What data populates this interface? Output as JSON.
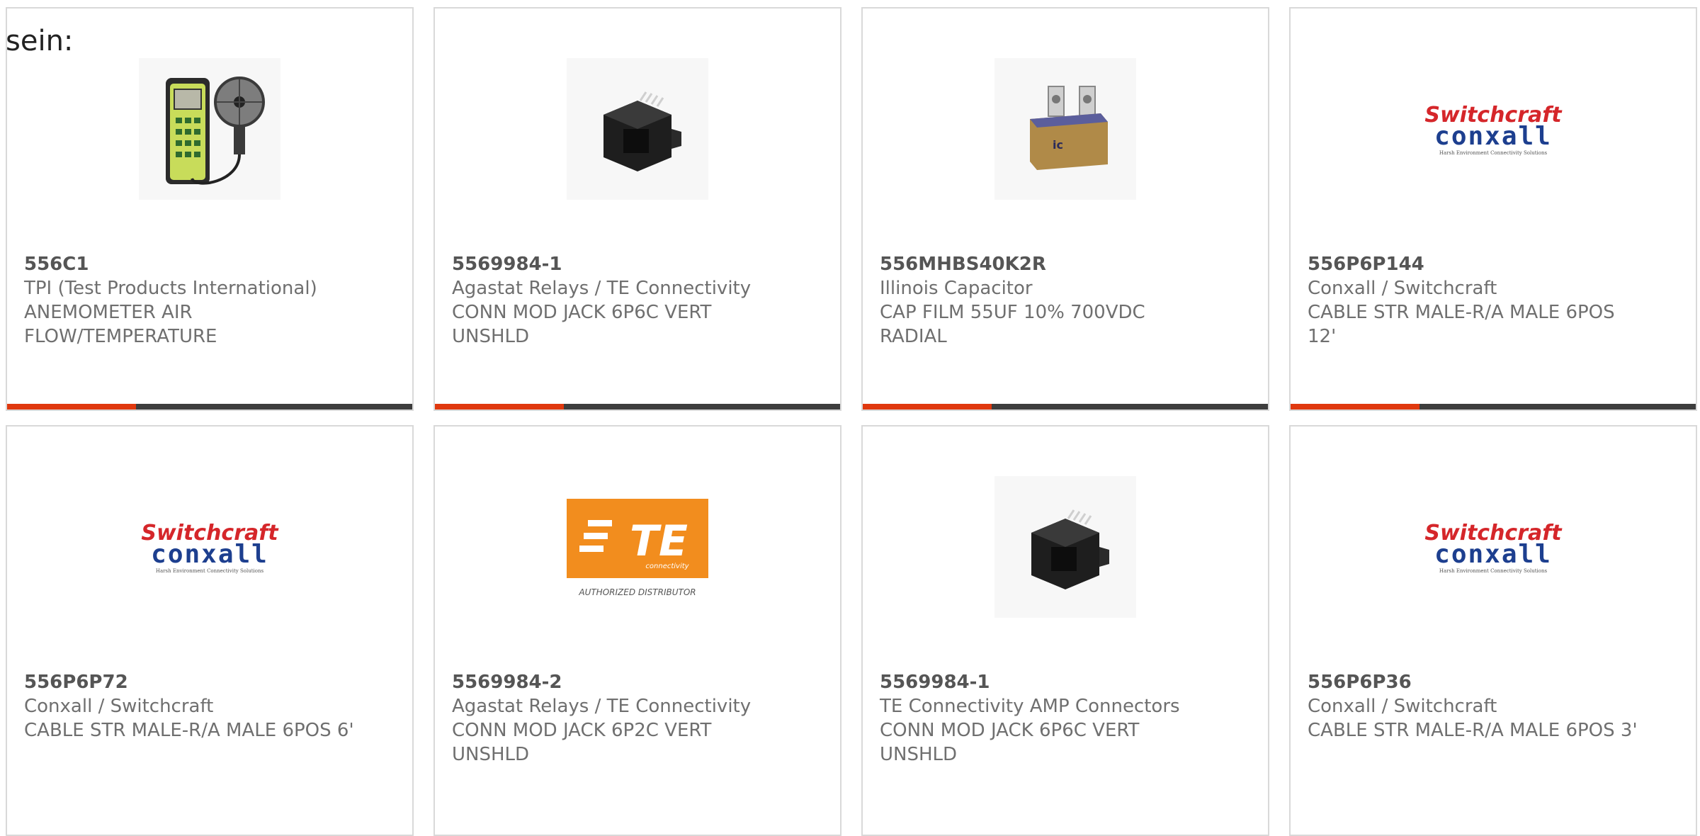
{
  "intro_text": "sein:",
  "colors": {
    "accent": "#e0380e",
    "bar": "#3d3d3d",
    "border": "#d9d9d9",
    "text": "#6f6f6f"
  },
  "products": [
    {
      "part_number": "556C1",
      "manufacturer": "TPI (Test Products International)",
      "description": "ANEMOMETER AIR FLOW/TEMPERATURE",
      "image": "anemometer-image"
    },
    {
      "part_number": "5569984-1",
      "manufacturer": "Agastat Relays / TE Connectivity",
      "description": "CONN MOD JACK 6P6C VERT UNSHLD",
      "image": "modular-jack-image"
    },
    {
      "part_number": "556MHBS40K2R",
      "manufacturer": "Illinois Capacitor",
      "description": "CAP FILM 55UF 10% 700VDC RADIAL",
      "image": "film-capacitor-image"
    },
    {
      "part_number": "556P6P144",
      "manufacturer": "Conxall / Switchcraft",
      "description": "CABLE STR MALE-R/A MALE 6POS 12'",
      "image": "switchcraft-conxall-logo"
    },
    {
      "part_number": "556P6P72",
      "manufacturer": "Conxall / Switchcraft",
      "description": "CABLE STR MALE-R/A MALE 6POS 6'",
      "image": "switchcraft-conxall-logo"
    },
    {
      "part_number": "5569984-2",
      "manufacturer": "Agastat Relays / TE Connectivity",
      "description": "CONN MOD JACK 6P2C VERT UNSHLD",
      "image": "te-connectivity-logo"
    },
    {
      "part_number": "5569984-1",
      "manufacturer": "TE Connectivity AMP Connectors",
      "description": "CONN MOD JACK 6P6C VERT UNSHLD",
      "image": "modular-jack-image"
    },
    {
      "part_number": "556P6P36",
      "manufacturer": "Conxall / Switchcraft",
      "description": "CABLE STR MALE-R/A MALE 6POS 3'",
      "image": "switchcraft-conxall-logo"
    }
  ],
  "logos": {
    "switchcraft": "Switchcraft",
    "conxall": "conxall",
    "conxall_tagline": "Harsh Environment Connectivity Solutions",
    "te_mark": "TE",
    "te_word": "connectivity",
    "te_distributor": "AUTHORIZED DISTRIBUTOR"
  }
}
